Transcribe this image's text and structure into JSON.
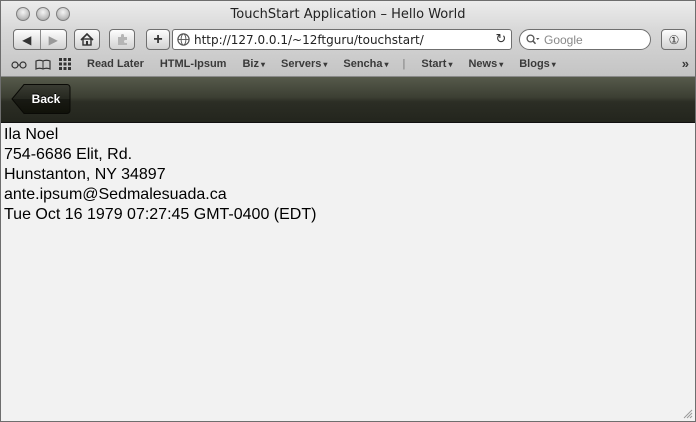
{
  "window": {
    "title": "TouchStart Application – Hello World"
  },
  "toolbar": {
    "back_arrow": "◀",
    "forward_arrow": "▶",
    "add_label": "+",
    "url": "http://127.0.0.1/~12ftguru/touchstart/",
    "reload_glyph": "↻",
    "search_placeholder": "Google",
    "info_glyph": "①"
  },
  "bookmarks": {
    "items": [
      {
        "label": "Read Later",
        "has_menu": false
      },
      {
        "label": "HTML-Ipsum",
        "has_menu": false
      },
      {
        "label": "Biz",
        "has_menu": true
      },
      {
        "label": "Servers",
        "has_menu": true
      },
      {
        "label": "Sencha",
        "has_menu": true
      },
      {
        "label": "Start",
        "has_menu": true
      },
      {
        "label": "News",
        "has_menu": true
      },
      {
        "label": "Blogs",
        "has_menu": true
      }
    ],
    "separator": "|",
    "menu_arrow": "▾",
    "overflow_glyph": "»"
  },
  "app": {
    "back_label": "Back",
    "toolbar_color": "#3c3f33"
  },
  "detail": {
    "name": "Ila Noel",
    "address": "754-6686 Elit, Rd.",
    "city_line": "Hunstanton, NY 34897",
    "email": "ante.ipsum@Sedmalesuada.ca",
    "date": "Tue Oct 16 1979 07:27:45 GMT-0400 (EDT)"
  },
  "icons": [
    "close-traffic-icon",
    "minimize-traffic-icon",
    "zoom-traffic-icon",
    "back-arrow-icon",
    "forward-arrow-icon",
    "home-icon",
    "puzzle-icon",
    "globe-icon",
    "reload-icon",
    "search-icon",
    "reading-glasses-icon",
    "book-icon",
    "grid-icon",
    "resize-grip-icon"
  ]
}
